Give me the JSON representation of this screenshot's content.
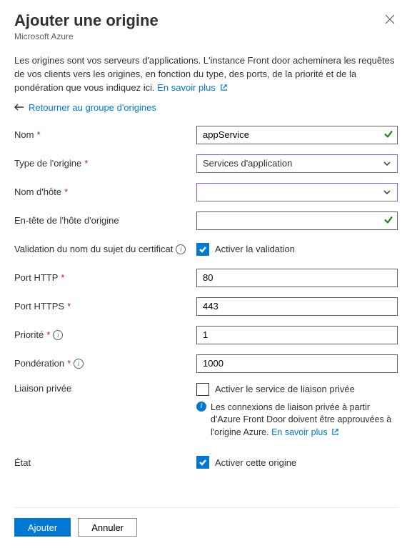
{
  "header": {
    "title": "Ajouter une origine",
    "subtitle": "Microsoft Azure"
  },
  "intro": {
    "text": "Les origines sont vos serveurs d'applications. L'instance Front door acheminera les requêtes de vos clients vers les origines, en fonction du type, des ports, de la priorité et de la pondération que vous indiquez ici.",
    "learn_more": "En savoir plus"
  },
  "back_link": "Retourner au groupe d'origines",
  "fields": {
    "name": {
      "label": "Nom",
      "value": "appService"
    },
    "origin_type": {
      "label": "Type de l'origine",
      "value": "Services d'application"
    },
    "host_name": {
      "label": "Nom d'hôte",
      "value": ""
    },
    "origin_host_header": {
      "label": "En-tête de l'hôte d'origine",
      "value": ""
    },
    "cert_validation": {
      "label": "Validation du nom du sujet du certificat",
      "checkbox_label": "Activer la validation"
    },
    "http_port": {
      "label": "Port HTTP",
      "value": "80"
    },
    "https_port": {
      "label": "Port HTTPS",
      "value": "443"
    },
    "priority": {
      "label": "Priorité",
      "value": "1"
    },
    "weight": {
      "label": "Pondération",
      "value": "1000"
    },
    "private_link": {
      "label": "Liaison privée",
      "checkbox_label": "Activer le service de liaison privée",
      "info_text": "Les connexions de liaison privée à partir d'Azure Front Door doivent être approuvées à l'origine Azure.",
      "learn_more": "En savoir plus"
    },
    "state": {
      "label": "État",
      "checkbox_label": "Activer cette origine"
    }
  },
  "footer": {
    "add": "Ajouter",
    "cancel": "Annuler"
  }
}
